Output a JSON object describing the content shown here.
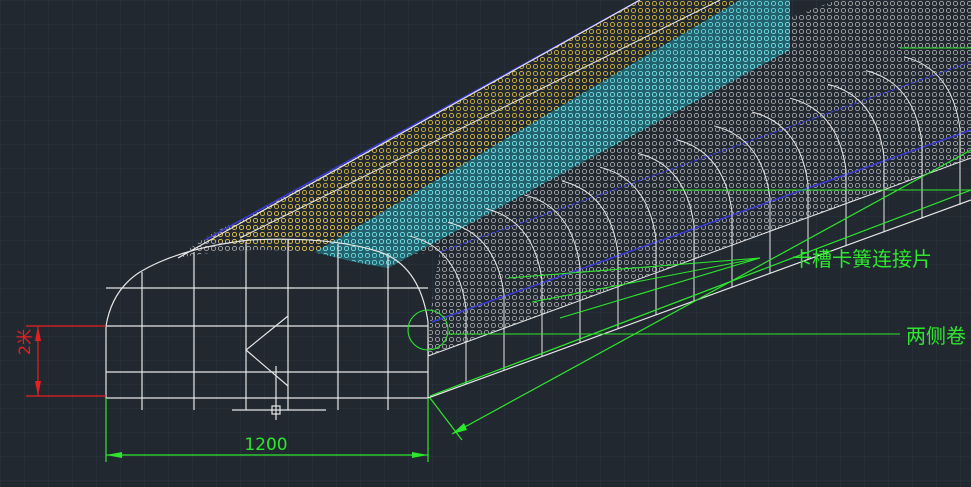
{
  "drawing": {
    "background_color": "#212830",
    "grid_color": "#2c3540",
    "structure_color": "#e6e6e6",
    "dimension_color": "#2ee62e",
    "height_dim_color": "#e62020",
    "film_colors": [
      "#d4b640",
      "#25c5d0",
      "#c8c8c8",
      "#3b3bd0"
    ],
    "width_dimension": "1200",
    "height_dimension": "2米",
    "callouts": [
      {
        "id": "clip-spring",
        "text": "卡槽卡簧连接片"
      },
      {
        "id": "side-roll",
        "text": "两侧卷"
      }
    ]
  }
}
